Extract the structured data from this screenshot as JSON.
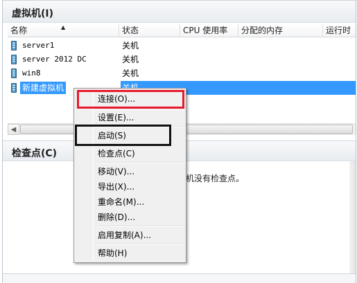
{
  "vm_panel": {
    "title": "虚拟机(I)",
    "columns": [
      "名称",
      "状态",
      "CPU 使用率",
      "分配的内存",
      "运行时"
    ],
    "rows": [
      {
        "name": "server1",
        "state": "关机"
      },
      {
        "name": "server 2012 DC",
        "state": "关机"
      },
      {
        "name": "win8",
        "state": "关机"
      },
      {
        "name": "新建虚拟机",
        "state": "关机"
      }
    ],
    "selected_index": 3
  },
  "checkpoint_panel": {
    "title": "检查点(C)",
    "empty_text": "机没有检查点。"
  },
  "context_menu": {
    "items": [
      {
        "label": "连接(O)..."
      },
      {
        "label": "设置(E)..."
      },
      {
        "label": "启动(S)"
      },
      {
        "label": "检查点(C)"
      },
      {
        "label": "移动(V)..."
      },
      {
        "label": "导出(X)..."
      },
      {
        "label": "重命名(M)..."
      },
      {
        "label": "删除(D)..."
      },
      {
        "label": "启用复制(A)..."
      },
      {
        "label": "帮助(H)"
      }
    ]
  },
  "colors": {
    "selection": "#3399ff",
    "highlight_red": "#e8192c",
    "highlight_black": "#111111"
  }
}
